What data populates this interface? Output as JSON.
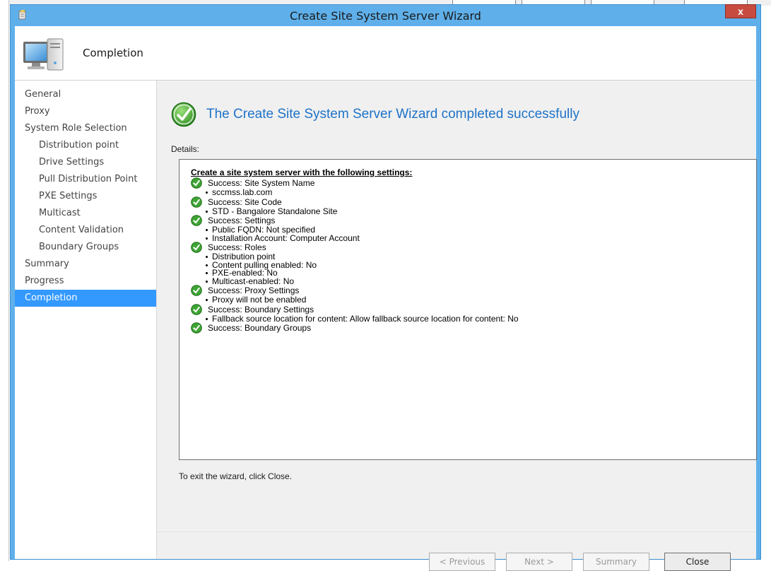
{
  "window": {
    "title": "Create Site System Server Wizard",
    "close_glyph": "x"
  },
  "header": {
    "title": "Completion"
  },
  "nav": {
    "items": [
      {
        "label": "General",
        "sub": false
      },
      {
        "label": "Proxy",
        "sub": false
      },
      {
        "label": "System Role Selection",
        "sub": false
      },
      {
        "label": "Distribution point",
        "sub": true
      },
      {
        "label": "Drive Settings",
        "sub": true
      },
      {
        "label": "Pull Distribution Point",
        "sub": true
      },
      {
        "label": "PXE Settings",
        "sub": true
      },
      {
        "label": "Multicast",
        "sub": true
      },
      {
        "label": "Content Validation",
        "sub": true
      },
      {
        "label": "Boundary Groups",
        "sub": true
      },
      {
        "label": "Summary",
        "sub": false
      },
      {
        "label": "Progress",
        "sub": false
      },
      {
        "label": "Completion",
        "sub": false,
        "active": true
      }
    ]
  },
  "main": {
    "success_message": "The Create Site System Server Wizard completed successfully",
    "details_label": "Details:",
    "details_heading": "Create a site system server with the following settings:",
    "entries": [
      {
        "status": "Success: Site System Name",
        "bullets": [
          "sccmss.lab.com"
        ]
      },
      {
        "status": "Success: Site Code",
        "bullets": [
          "STD - Bangalore Standalone Site"
        ]
      },
      {
        "status": "Success: Settings",
        "bullets": [
          "Public FQDN: Not specified",
          "Installation Account: Computer Account"
        ]
      },
      {
        "status": "Success: Roles",
        "bullets": [
          "Distribution point",
          "Content pulling enabled: No",
          "PXE-enabled: No",
          "Multicast-enabled: No"
        ]
      },
      {
        "status": "Success: Proxy Settings",
        "bullets": [
          "Proxy will not be enabled"
        ]
      },
      {
        "status": "Success: Boundary Settings",
        "bullets": [
          "Fallback source location for content: Allow fallback source location for content: No"
        ]
      },
      {
        "status": "Success: Boundary Groups",
        "bullets": []
      }
    ],
    "exit_text": "To exit the wizard, click Close."
  },
  "buttons": {
    "previous": "< Previous",
    "next": "Next >",
    "summary": "Summary",
    "close": "Close"
  },
  "colors": {
    "window_frame": "#5fb0ea",
    "nav_active": "#3399ff",
    "success_text": "#1e73c8",
    "check_green": "#3fa535"
  }
}
